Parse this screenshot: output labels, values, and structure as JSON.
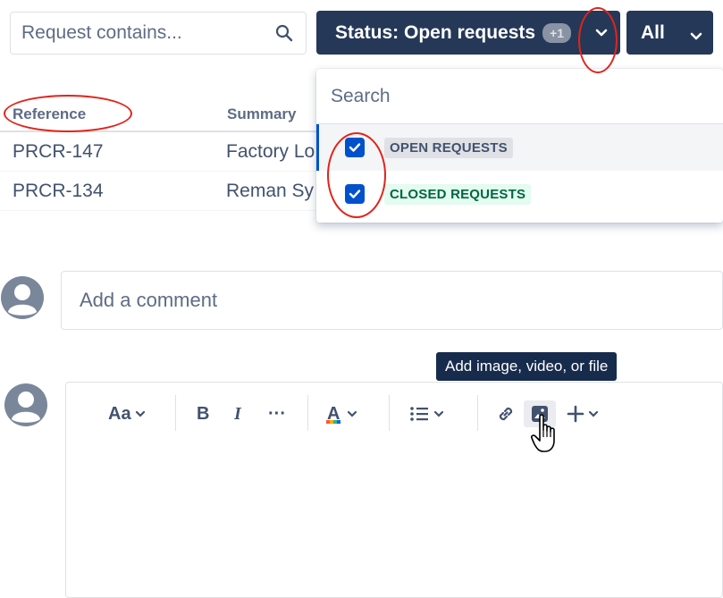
{
  "filters": {
    "search_placeholder": "Request contains...",
    "status_label": "Status: Open requests",
    "status_badge": "+1",
    "all_label": "All"
  },
  "table": {
    "columns": [
      "Reference",
      "Summary"
    ],
    "rows": [
      {
        "reference": "PRCR-147",
        "summary": "Factory Lo"
      },
      {
        "reference": "PRCR-134",
        "summary": "Reman Sy"
      }
    ]
  },
  "dropdown": {
    "search_placeholder": "Search",
    "options": [
      {
        "label": "OPEN REQUESTS",
        "checked": true
      },
      {
        "label": "CLOSED REQUESTS",
        "checked": true
      }
    ]
  },
  "comment": {
    "placeholder": "Add a comment"
  },
  "editor": {
    "tooltip": "Add image, video, or file",
    "text_style_label": "Aa",
    "bold_label": "B",
    "italic_label": "I",
    "more_label": "···",
    "text_color_label": "A"
  },
  "colors": {
    "primary_dark": "#253858",
    "checkbox": "#0052cc",
    "annotation": "#e2231a",
    "closed_lozenge_text": "#006644"
  }
}
